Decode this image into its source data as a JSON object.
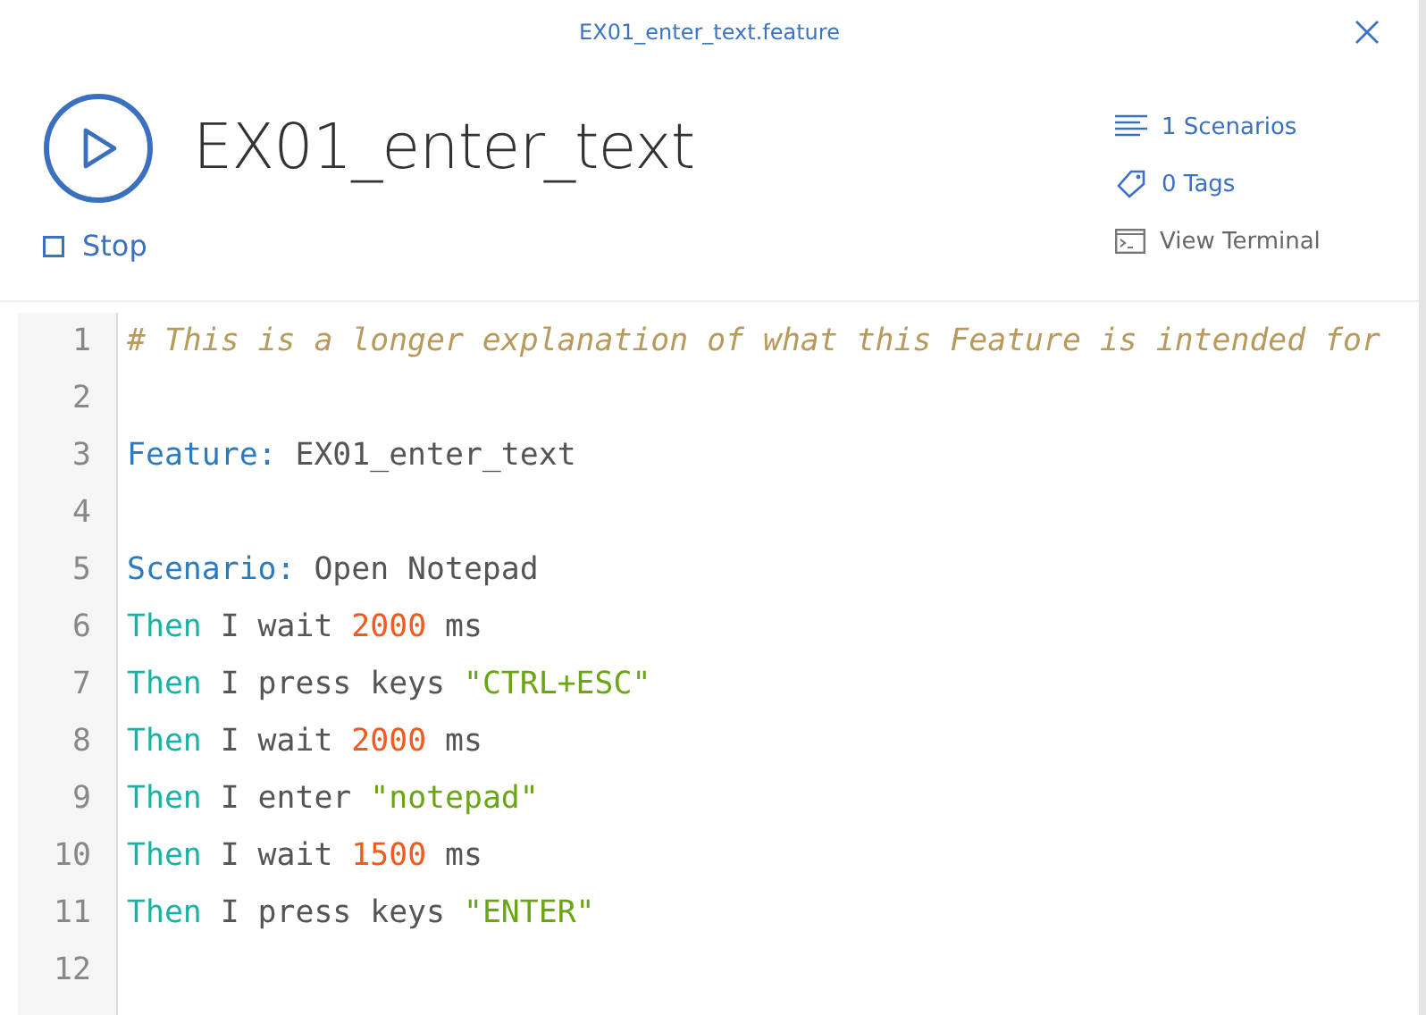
{
  "window": {
    "title": "EX01_enter_text.feature"
  },
  "header": {
    "title": "EX01_enter_text",
    "stop": "Stop"
  },
  "links": [
    {
      "kind": "scenarios",
      "label": "1 Scenarios"
    },
    {
      "kind": "tags",
      "label": "0 Tags"
    },
    {
      "kind": "terminal",
      "label": "View Terminal"
    }
  ],
  "editor": {
    "lines": [
      {
        "number": "1",
        "tokens": [
          {
            "kind": "comment",
            "text": "# This is a longer explanation of what this Feature is intended for"
          }
        ]
      },
      {
        "number": "2"
      },
      {
        "number": "3",
        "tokens": [
          {
            "kind": "keyword",
            "text": "Feature:"
          },
          {
            "kind": "text",
            "text": "EX01_enter_text"
          }
        ]
      },
      {
        "number": "4"
      },
      {
        "number": "5",
        "tokens": [
          {
            "kind": "keyword",
            "text": "Scenario:"
          },
          {
            "kind": "text",
            "text": "Open Notepad"
          }
        ]
      },
      {
        "number": "6",
        "tokens": [
          {
            "kind": "step",
            "text": "Then"
          },
          {
            "kind": "text",
            "text": "I wait"
          },
          {
            "kind": "number",
            "text": "2000"
          },
          {
            "kind": "text",
            "text": "ms"
          }
        ]
      },
      {
        "number": "7",
        "tokens": [
          {
            "kind": "step",
            "text": "Then"
          },
          {
            "kind": "text",
            "text": "I press keys"
          },
          {
            "kind": "string",
            "text": "\"CTRL+ESC\""
          }
        ]
      },
      {
        "number": "8",
        "tokens": [
          {
            "kind": "step",
            "text": "Then"
          },
          {
            "kind": "text",
            "text": "I wait"
          },
          {
            "kind": "number",
            "text": "2000"
          },
          {
            "kind": "text",
            "text": "ms"
          }
        ]
      },
      {
        "number": "9",
        "tokens": [
          {
            "kind": "step",
            "text": "Then"
          },
          {
            "kind": "text",
            "text": "I enter"
          },
          {
            "kind": "string",
            "text": "\"notepad\""
          }
        ]
      },
      {
        "number": "10",
        "tokens": [
          {
            "kind": "step",
            "text": "Then"
          },
          {
            "kind": "text",
            "text": "I wait"
          },
          {
            "kind": "number",
            "text": "1500"
          },
          {
            "kind": "text",
            "text": "ms"
          }
        ]
      },
      {
        "number": "11",
        "tokens": [
          {
            "kind": "step",
            "text": "Then"
          },
          {
            "kind": "text",
            "text": "I press keys"
          },
          {
            "kind": "string",
            "text": "\"ENTER\""
          }
        ]
      },
      {
        "number": "12"
      }
    ]
  }
}
